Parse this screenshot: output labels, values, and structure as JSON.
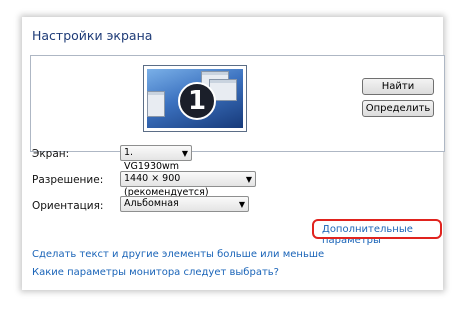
{
  "window": {
    "title": "Настройки экрана"
  },
  "preview": {
    "monitor_number": "1",
    "buttons": {
      "find": "Найти",
      "identify": "Определить"
    }
  },
  "settings": {
    "display": {
      "label": "Экран:",
      "value": "1. VG1930wm"
    },
    "resolution": {
      "label": "Разрешение:",
      "value": "1440 × 900 (рекомендуется)"
    },
    "orientation": {
      "label": "Ориентация:",
      "value": "Альбомная"
    }
  },
  "links": {
    "advanced": "Дополнительные параметры",
    "text_size": "Сделать текст и другие элементы больше или меньше",
    "which_settings": "Какие параметры монитора следует выбрать?"
  },
  "colors": {
    "link": "#1a64b8",
    "highlight": "#e0231e",
    "title": "#1e3b77"
  }
}
